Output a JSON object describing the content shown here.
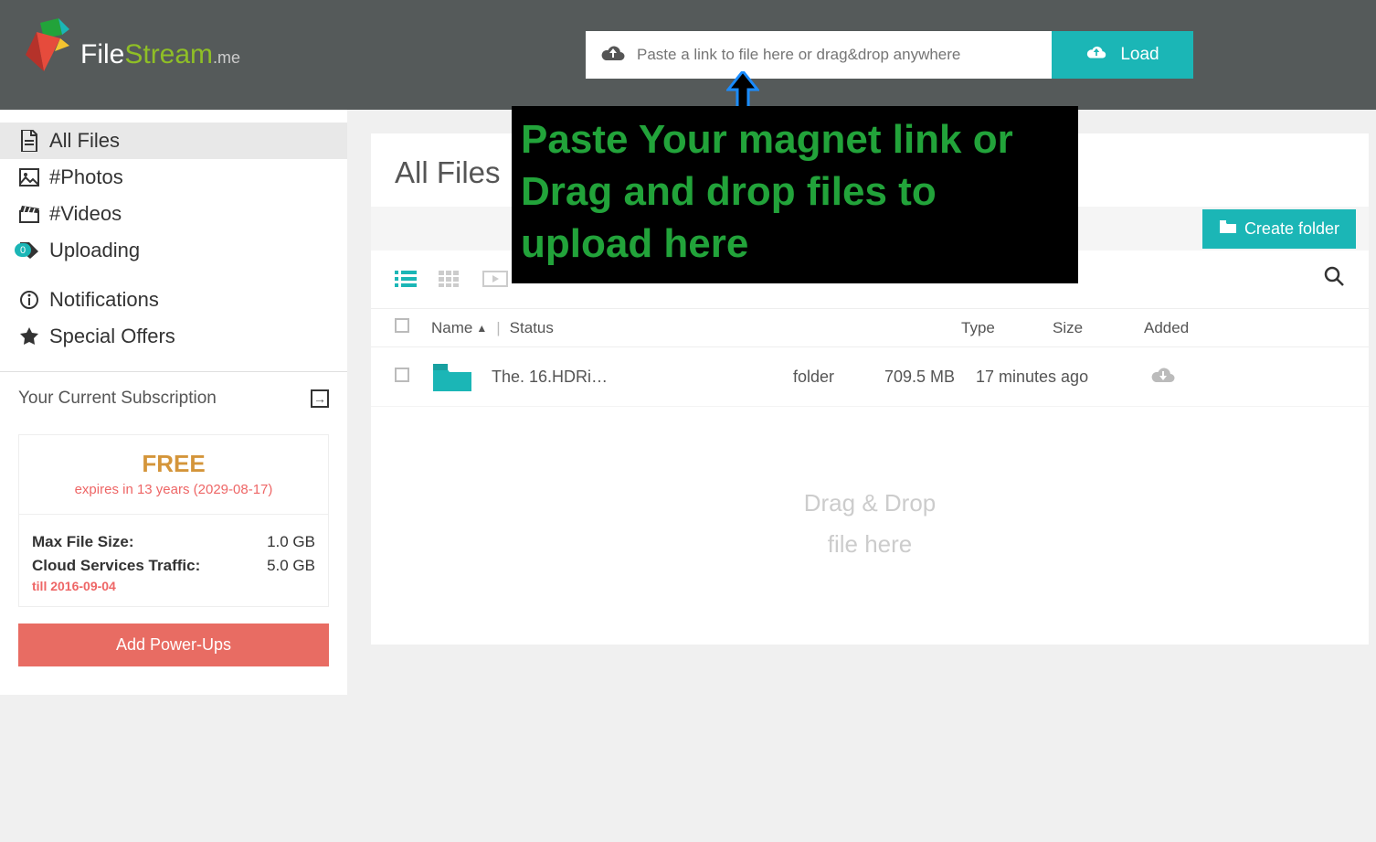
{
  "header": {
    "logo_file": "File",
    "logo_stream": "Stream",
    "logo_me": ".me",
    "link_placeholder": "Paste a link to file here or drag&drop anywhere",
    "load_label": "Load"
  },
  "annotation": {
    "text": "Paste Your magnet link or Drag and drop files to upload here"
  },
  "sidebar": {
    "items": [
      {
        "label": "All Files"
      },
      {
        "label": "#Photos"
      },
      {
        "label": "#Videos"
      },
      {
        "label": "Uploading",
        "badge": "0"
      },
      {
        "label": "Notifications"
      },
      {
        "label": "Special Offers"
      }
    ],
    "subscription_heading": "Your Current Subscription",
    "plan_name": "FREE",
    "plan_expires": "expires in 13 years (2029-08-17)",
    "limits": {
      "max_file_label": "Max File Size:",
      "max_file_value": "1.0 GB",
      "cloud_traffic_label": "Cloud Services Traffic:",
      "cloud_traffic_value": "5.0 GB",
      "cloud_till": "till 2016-09-04"
    },
    "powerups_label": "Add Power-Ups"
  },
  "content": {
    "title": "All Files",
    "create_folder_label": "Create folder",
    "columns": {
      "name": "Name",
      "status": "Status",
      "type": "Type",
      "size": "Size",
      "added": "Added"
    },
    "rows": [
      {
        "name": "The.        16.HDRi…",
        "type": "folder",
        "size": "709.5 MB",
        "added": "17 minutes ago"
      }
    ],
    "dropzone_line1": "Drag & Drop",
    "dropzone_line2": "file here"
  }
}
